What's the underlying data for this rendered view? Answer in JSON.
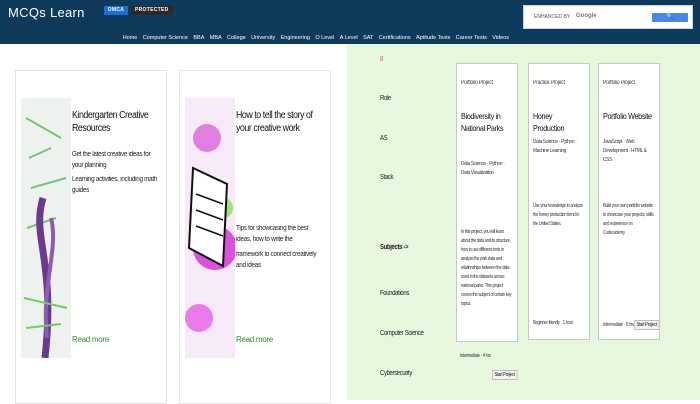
{
  "header": {
    "logo": "MCQs Learn",
    "badge_dmca": "DMCA",
    "badge_protected": "PROTECTED",
    "search_label": "ENHANCED BY",
    "search_brand": "Google",
    "search_button_icon": "search-icon"
  },
  "nav": [
    "Home",
    "Computer Science",
    "BBA",
    "MBA",
    "College",
    "University",
    "Engineering",
    "O Level",
    "A Level",
    "SAT",
    "Certifications",
    "Aptitude Tests",
    "Career Tests",
    "Videos"
  ],
  "cards": [
    {
      "title": "Kindergarten Creative Resources",
      "desc": "Get the latest creative ideas for your planning",
      "desc2": "Learning activities, including math guides",
      "link": "Read more"
    },
    {
      "title": "How to tell the story of your creative work",
      "desc": "Tips for showcasing the best ideas, how to write the",
      "desc2": "framework to connect creatively and ideas",
      "link": "Read more"
    }
  ],
  "right_labels": {
    "l1": "8",
    "l2": "Role",
    "l3": "AS",
    "l4": "Stack",
    "subjects": "Subjects",
    "subjects_arrow": "->",
    "s1": "Foundations",
    "s2": "Computer Science",
    "s3": "Cybersecurity"
  },
  "projects": [
    {
      "type": "Portfolio Project",
      "title": "Biodiversity in National Parks",
      "tags": "Data Science · Python · Data Visualization",
      "desc": "In this project, you will learn about the data and its structure, how to use different tools to analyze the park data and relationships between the data used in the datasets across national parks. This project covers the subject of certain key topics.",
      "foot": "Intermediate · 4 hrs",
      "btn": "Start Project"
    },
    {
      "type": "Practice Project",
      "title": "Honey Production",
      "tags": "Data Science · Python · Machine Learning",
      "desc": "Use your knowledge to analyze the honey production trend in the United States.",
      "foot": "Beginner-friendly · 1 hour",
      "btn": "Start Project"
    },
    {
      "type": "Portfolio Project",
      "title": "Portfolio Website",
      "tags": "JavaScript · Web Development · HTML & CSS",
      "desc": "Build your own portfolio website to showcase your projects, skills and experience on Codecademy.",
      "foot": "Intermediate · 5 hrs",
      "btn": "Start Project"
    }
  ]
}
